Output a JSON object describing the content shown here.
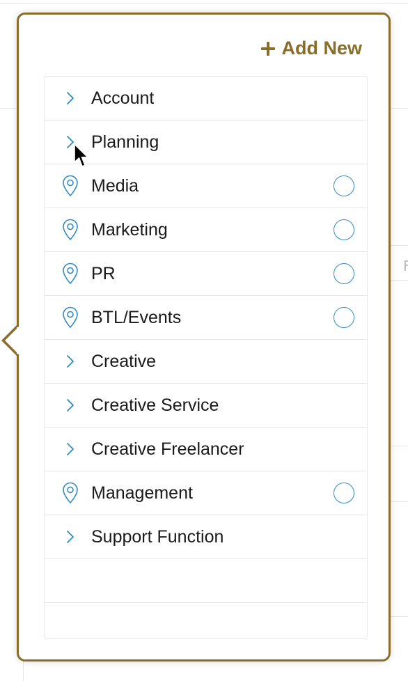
{
  "header": {
    "add_new_label": "Add New"
  },
  "colors": {
    "accent": "#8b6d2a",
    "icon_blue": "#2f8bc4"
  },
  "list": {
    "items": [
      {
        "label": "Account",
        "icon": "chevron-right-icon",
        "has_radio": false
      },
      {
        "label": "Planning",
        "icon": "chevron-right-icon",
        "has_radio": false
      },
      {
        "label": "Media",
        "icon": "location-pin-icon",
        "has_radio": true
      },
      {
        "label": "Marketing",
        "icon": "location-pin-icon",
        "has_radio": true
      },
      {
        "label": "PR",
        "icon": "location-pin-icon",
        "has_radio": true
      },
      {
        "label": "BTL/Events",
        "icon": "location-pin-icon",
        "has_radio": true
      },
      {
        "label": "Creative",
        "icon": "chevron-right-icon",
        "has_radio": false
      },
      {
        "label": "Creative Service",
        "icon": "chevron-right-icon",
        "has_radio": false
      },
      {
        "label": "Creative Freelancer",
        "icon": "chevron-right-icon",
        "has_radio": false
      },
      {
        "label": "Management",
        "icon": "location-pin-icon",
        "has_radio": true
      },
      {
        "label": "Support Function",
        "icon": "chevron-right-icon",
        "has_radio": false
      }
    ]
  },
  "background": {
    "right_fragment_text": "F"
  }
}
